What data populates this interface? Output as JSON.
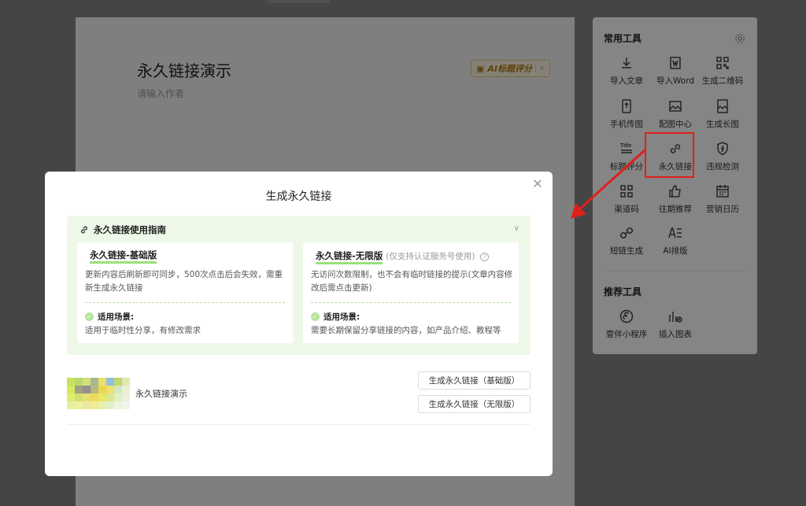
{
  "editor": {
    "title": "永久链接演示",
    "author_placeholder": "请输入作者",
    "ai_button": "AI标题评分"
  },
  "tools_panel": {
    "section1_title": "常用工具",
    "section2_title": "推荐工具",
    "tools": [
      {
        "label": "导入文章",
        "icon": "import-icon"
      },
      {
        "label": "导入Word",
        "icon": "word-icon"
      },
      {
        "label": "生成二维码",
        "icon": "qrcode-icon"
      },
      {
        "label": "手机传图",
        "icon": "phone-upload-icon"
      },
      {
        "label": "配图中心",
        "icon": "image-icon"
      },
      {
        "label": "生成长图",
        "icon": "long-image-icon"
      },
      {
        "label": "标题评分",
        "icon": "title-icon"
      },
      {
        "label": "永久链接",
        "icon": "link-icon"
      },
      {
        "label": "违规检测",
        "icon": "shield-icon"
      },
      {
        "label": "渠道码",
        "icon": "channel-qrcode-icon"
      },
      {
        "label": "往期推荐",
        "icon": "thumbs-up-icon"
      },
      {
        "label": "营销日历",
        "icon": "calendar-icon"
      },
      {
        "label": "短链生成",
        "icon": "short-link-icon"
      },
      {
        "label": "AI排版",
        "icon": "ai-layout-icon"
      }
    ],
    "recommended": [
      {
        "label": "壹伴小程序",
        "icon": "mini-program-icon"
      },
      {
        "label": "插入图表",
        "icon": "chart-insert-icon"
      }
    ]
  },
  "modal": {
    "title": "生成永久链接",
    "guide_title": "永久链接使用指南",
    "basic": {
      "title": "永久链接-基础版",
      "desc": "更新内容后刷新即可同步，500次点击后会失效，需重新生成永久链接",
      "scene_label": "适用场景:",
      "scene_text": "适用于临时性分享，有修改需求"
    },
    "unlimited": {
      "title": "永久链接-无限版",
      "note": "(仅支持认证服务号使用)",
      "desc": "无访问次数限制，也不会有临时链接的提示(文章内容修改后需点击更新)",
      "scene_label": "适用场景:",
      "scene_text": "需要长期保留分享链接的内容，如产品介绍、教程等"
    },
    "article_title": "永久链接演示",
    "btn_basic": "生成永久链接（基础版）",
    "btn_unlimited": "生成永久链接（无限版）"
  },
  "colors": {
    "accent_green": "#7ed957",
    "highlight_red": "#e0201a",
    "guide_bg": "#eef8e8"
  }
}
